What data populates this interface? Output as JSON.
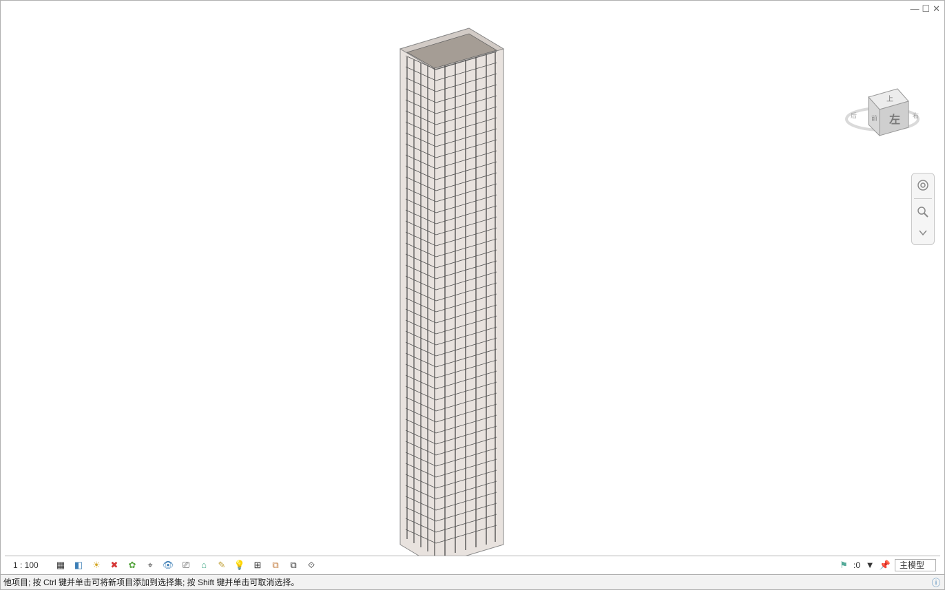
{
  "window_controls": {
    "minimize": "—",
    "restore": "☐",
    "close": "✕"
  },
  "viewcube": {
    "top": "上",
    "front": "左",
    "labels_small": [
      "前",
      "后",
      "右"
    ]
  },
  "nav_panel": {
    "home": "home-icon",
    "zoom": "zoom-icon",
    "dropdown": "chevron-down-icon"
  },
  "view_control_bar": {
    "scale": "1 : 100",
    "icons": [
      "model-graphics-icon",
      "box-icon",
      "sun-icon",
      "shadow-icon",
      "render-icon",
      "crop-icon",
      "hide-icon",
      "reveal-icon",
      "properties-icon",
      "pin-icon",
      "ruler-icon",
      "section-box-icon",
      "temporary-view-icon",
      "filter-icon",
      "extents-icon"
    ]
  },
  "status_right": {
    "flag": "selection-flag-icon",
    "num_label": ":0",
    "items": [
      "filter-icon",
      "pushpin-icon"
    ],
    "dropdown_value": "主模型"
  },
  "status_bar": {
    "hint": "他项目; 按 Ctrl 键并单击可将新项目添加到选择集; 按 Shift 键并单击可取消选择。",
    "info_icon": "info-icon"
  }
}
